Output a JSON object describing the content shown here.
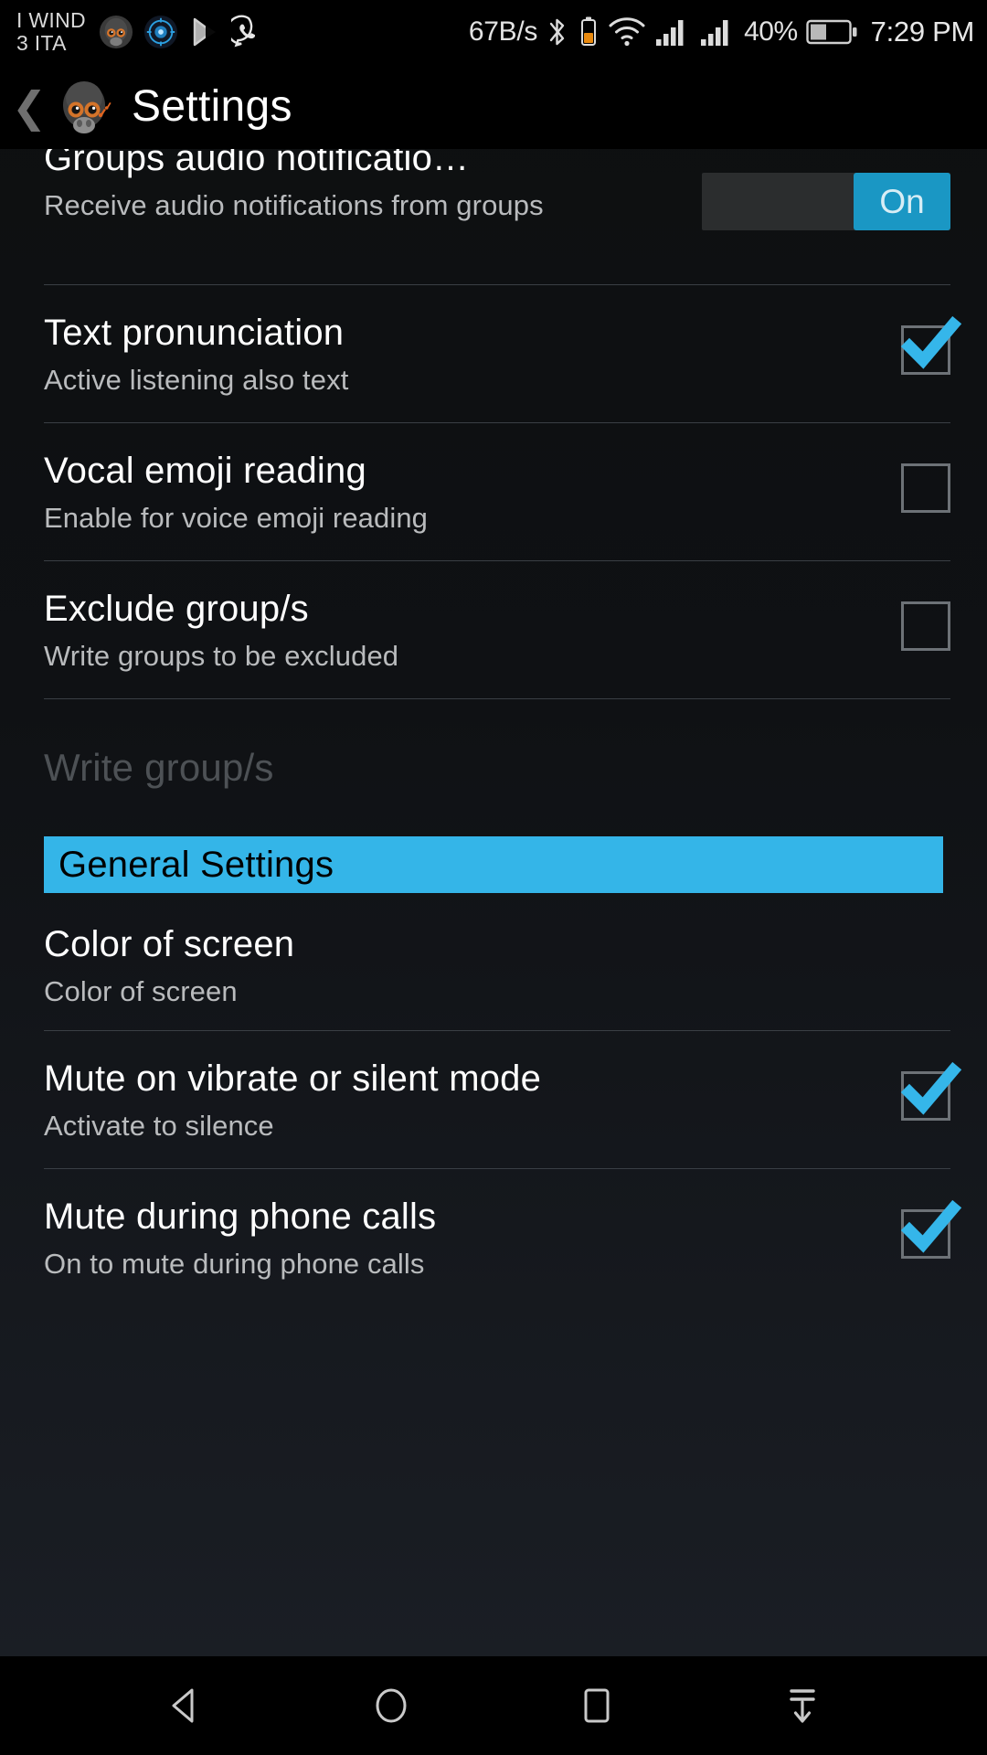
{
  "status_bar": {
    "carrier_line1": "I WIND",
    "carrier_line2": "3 ITA",
    "net_speed": "67B/s",
    "battery_percent": "40%",
    "clock": "7:29 PM",
    "icons": [
      "app-monkey-icon",
      "app-blue-icon",
      "play-store-icon",
      "whatsapp-icon",
      "bluetooth-icon",
      "battery-saver-icon",
      "wifi-icon",
      "signal-sim1-icon",
      "signal-sim2-icon",
      "battery-icon"
    ]
  },
  "header": {
    "back_label": "❮",
    "title": "Settings",
    "app_icon": "gorilla-app-icon"
  },
  "colors": {
    "accent": "#34b5e8",
    "switch_on": "#1a97c4",
    "check": "#35b6ea",
    "background": "#12151a",
    "divider": "#3a3f45"
  },
  "rows": [
    {
      "title": "Groups audio notificatio…",
      "subtitle": "Receive audio notifications from groups",
      "control": "switch",
      "switch_label": "On",
      "checked": true,
      "clipped": true
    },
    {
      "title": "Text pronunciation",
      "subtitle": "Active listening also text",
      "control": "checkbox",
      "checked": true
    },
    {
      "title": "Vocal emoji reading",
      "subtitle": "Enable for voice emoji reading",
      "control": "checkbox",
      "checked": false
    },
    {
      "title": "Exclude group/s",
      "subtitle": "Write groups to be excluded",
      "control": "checkbox",
      "checked": false
    }
  ],
  "group_input": {
    "placeholder": "Write group/s",
    "value": ""
  },
  "section": {
    "label": "General Settings"
  },
  "general_rows": [
    {
      "title": "Color of screen",
      "subtitle": "Color of screen",
      "control": "none",
      "checked": false
    },
    {
      "title": "Mute on vibrate or silent mode",
      "subtitle": "Activate to silence",
      "control": "checkbox",
      "checked": true
    },
    {
      "title": "Mute during phone calls",
      "subtitle": "On to mute during phone calls",
      "control": "checkbox",
      "checked": true
    }
  ],
  "navbar": {
    "back": "back-nav-icon",
    "home": "home-nav-icon",
    "recents": "recents-nav-icon",
    "hide": "hide-navbar-icon"
  }
}
